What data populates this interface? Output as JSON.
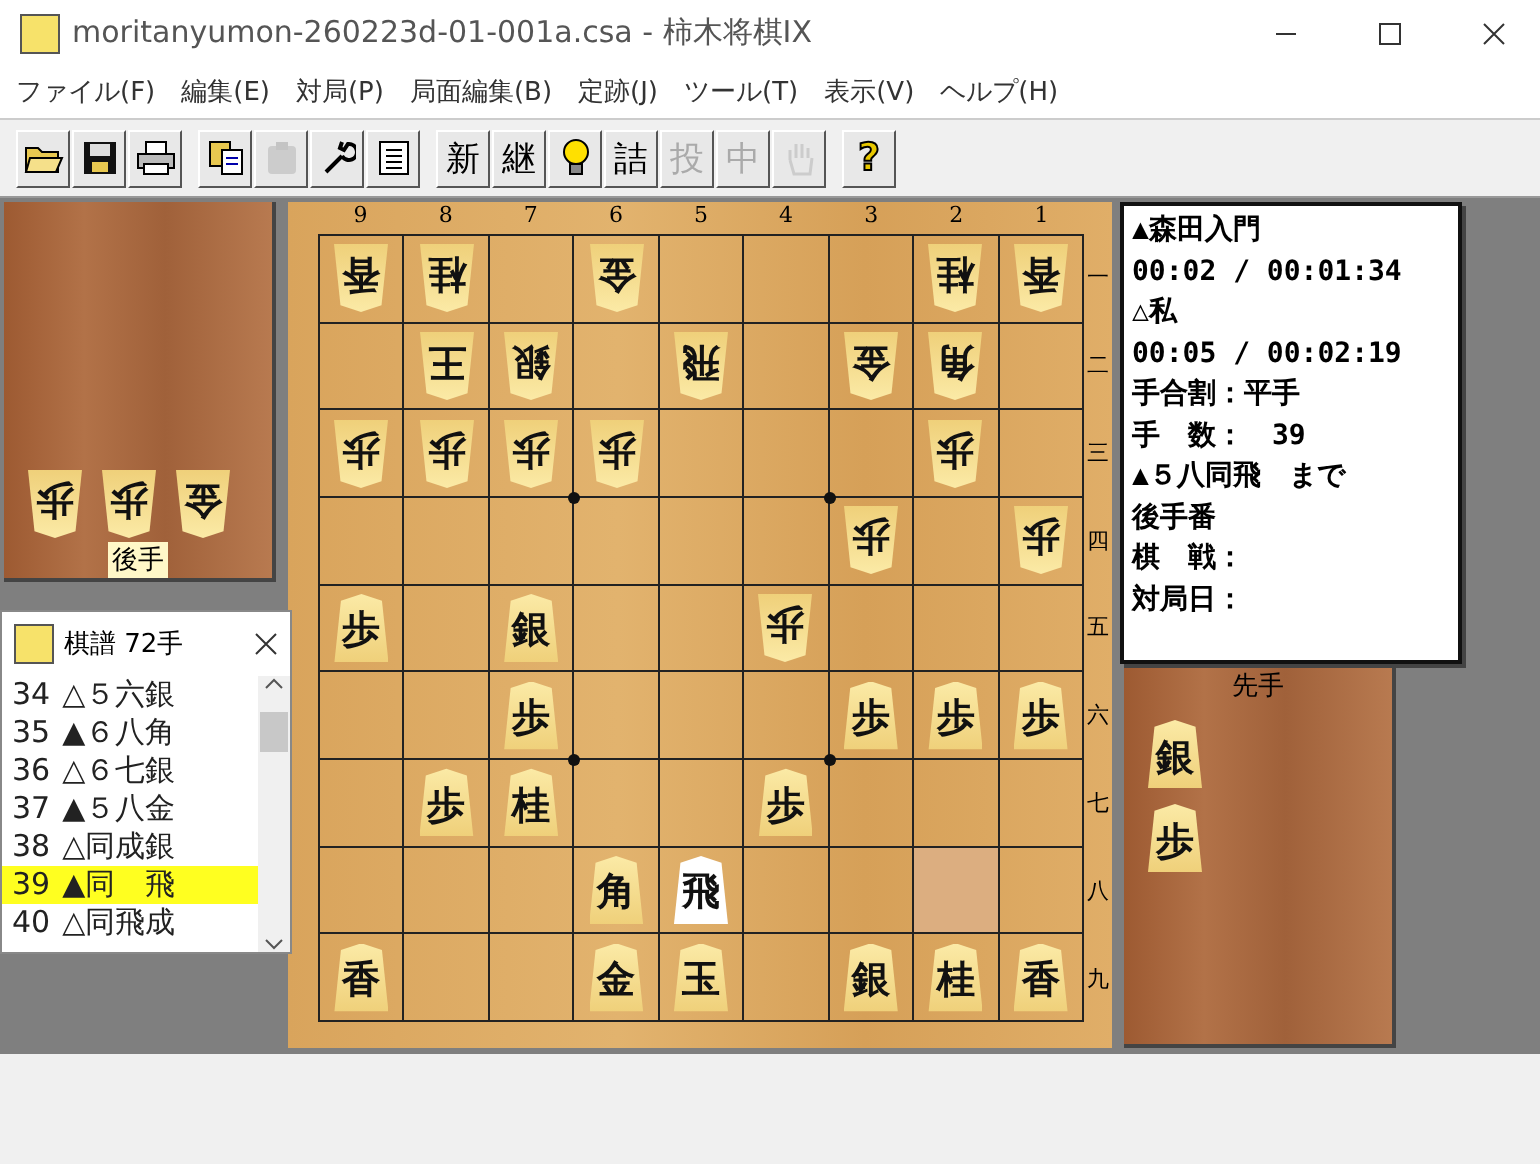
{
  "window": {
    "title": "moritanyumon-260223d-01-001a.csa - 柿木将棋IX"
  },
  "menu": [
    "ファイル(F)",
    "編集(E)",
    "対局(P)",
    "局面編集(B)",
    "定跡(J)",
    "ツール(T)",
    "表示(V)",
    "ヘルプ(H)"
  ],
  "toolbar": [
    [
      {
        "kind": "open",
        "disabled": false
      },
      {
        "kind": "save",
        "disabled": false
      },
      {
        "kind": "print",
        "disabled": false
      }
    ],
    [
      {
        "kind": "copy",
        "disabled": false
      },
      {
        "kind": "paste",
        "disabled": true
      },
      {
        "kind": "wrench",
        "disabled": false
      },
      {
        "kind": "list",
        "disabled": false
      }
    ],
    [
      {
        "kind": "text",
        "label": "新",
        "disabled": false
      },
      {
        "kind": "text",
        "label": "継",
        "disabled": false
      },
      {
        "kind": "bulb",
        "disabled": false
      },
      {
        "kind": "text",
        "label": "詰",
        "disabled": false
      },
      {
        "kind": "text",
        "label": "投",
        "disabled": true
      },
      {
        "kind": "text",
        "label": "中",
        "disabled": true
      },
      {
        "kind": "hand",
        "disabled": true
      }
    ],
    [
      {
        "kind": "help",
        "label": "?",
        "disabled": false
      }
    ]
  ],
  "gote_hand": {
    "label": "後手",
    "pieces": [
      "歩",
      "歩",
      "金"
    ]
  },
  "kifu_window": {
    "title": "棋譜 72手",
    "moves": [
      {
        "number": "34",
        "move": "△５六銀",
        "selected": false
      },
      {
        "number": "35",
        "move": "▲６八角",
        "selected": false
      },
      {
        "number": "36",
        "move": "△６七銀",
        "selected": false
      },
      {
        "number": "37",
        "move": "▲５八金",
        "selected": false
      },
      {
        "number": "38",
        "move": "△同成銀",
        "selected": false
      },
      {
        "number": "39",
        "move": "▲同　飛",
        "selected": true
      },
      {
        "number": "40",
        "move": "△同飛成",
        "selected": false
      }
    ]
  },
  "board": {
    "files": [
      "9",
      "8",
      "7",
      "6",
      "5",
      "4",
      "3",
      "2",
      "1"
    ],
    "ranks": [
      "一",
      "二",
      "三",
      "四",
      "五",
      "六",
      "七",
      "八",
      "九"
    ],
    "rows": [
      [
        {
          "piece": "香",
          "gote": true
        },
        {
          "piece": "桂",
          "gote": true
        },
        {},
        {
          "piece": "金",
          "gote": true
        },
        {},
        {},
        {},
        {
          "piece": "桂",
          "gote": true
        },
        {
          "piece": "香",
          "gote": true
        }
      ],
      [
        {},
        {
          "piece": "王",
          "gote": true
        },
        {
          "piece": "銀",
          "gote": true
        },
        {},
        {
          "piece": "飛",
          "gote": true
        },
        {},
        {
          "piece": "金",
          "gote": true
        },
        {
          "piece": "角",
          "gote": true
        },
        {}
      ],
      [
        {
          "piece": "歩",
          "gote": true
        },
        {
          "piece": "歩",
          "gote": true
        },
        {
          "piece": "歩",
          "gote": true
        },
        {
          "piece": "歩",
          "gote": true
        },
        {},
        {},
        {},
        {
          "piece": "歩",
          "gote": true
        },
        {}
      ],
      [
        {},
        {},
        {},
        {},
        {},
        {},
        {
          "piece": "歩",
          "gote": true
        },
        {},
        {
          "piece": "歩",
          "gote": true
        }
      ],
      [
        {
          "piece": "歩",
          "gote": false
        },
        {},
        {
          "piece": "銀",
          "gote": false
        },
        {},
        {},
        {
          "piece": "歩",
          "gote": true
        },
        {},
        {},
        {}
      ],
      [
        {},
        {},
        {
          "piece": "歩",
          "gote": false
        },
        {},
        {},
        {},
        {
          "piece": "歩",
          "gote": false
        },
        {
          "piece": "歩",
          "gote": false
        },
        {
          "piece": "歩",
          "gote": false
        }
      ],
      [
        {},
        {
          "piece": "歩",
          "gote": false
        },
        {
          "piece": "桂",
          "gote": false
        },
        {},
        {},
        {
          "piece": "歩",
          "gote": false
        },
        {},
        {},
        {}
      ],
      [
        {},
        {},
        {},
        {
          "piece": "角",
          "gote": false
        },
        {
          "piece": "飛",
          "gote": false,
          "last_move": true
        },
        {},
        {},
        {
          "moved_from": true
        },
        {}
      ],
      [
        {
          "piece": "香",
          "gote": false
        },
        {},
        {},
        {
          "piece": "金",
          "gote": false
        },
        {
          "piece": "玉",
          "gote": false
        },
        {},
        {
          "piece": "銀",
          "gote": false
        },
        {
          "piece": "桂",
          "gote": false
        },
        {
          "piece": "香",
          "gote": false
        }
      ]
    ]
  },
  "info": [
    "▲森田入門",
    "00:02 / 00:01:34",
    "△私",
    "00:05 / 00:02:19",
    "手合割：平手",
    "手　数：　39",
    "▲５八同飛　まで",
    "後手番",
    "棋　戦：",
    "対局日："
  ],
  "sente_hand": {
    "label": "先手",
    "pieces": [
      "銀",
      "歩"
    ]
  }
}
